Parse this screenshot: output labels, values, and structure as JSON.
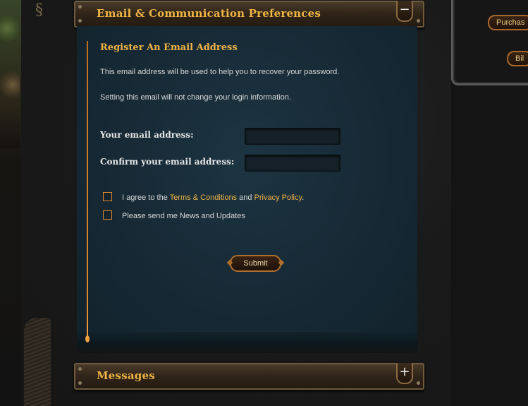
{
  "right_panel": {
    "purchase_label": "Purchas",
    "billing_label": "Bil"
  },
  "email_section": {
    "header_title": "Email & Communication Preferences",
    "toggle": "−",
    "register_title": "Register An Email Address",
    "desc1": "This email address will be used to help you to recover your password.",
    "desc2": "Setting this email will not change your login information.",
    "email_label": "Your email address:",
    "email_value": "",
    "confirm_label": "Confirm your email address:",
    "confirm_value": "",
    "agree_prefix": "I agree to the ",
    "terms_link": "Terms & Conditions",
    "agree_and": " and ",
    "privacy_link": "Privacy Policy",
    "agree_suffix": ".",
    "news_label": "Please send me News and Updates",
    "submit_label": "Submit"
  },
  "messages_section": {
    "header_title": "Messages",
    "toggle": "+"
  },
  "colors": {
    "accent": "#f0b445",
    "panel_bg": "#172a36",
    "border_orange": "#e08a2a"
  }
}
